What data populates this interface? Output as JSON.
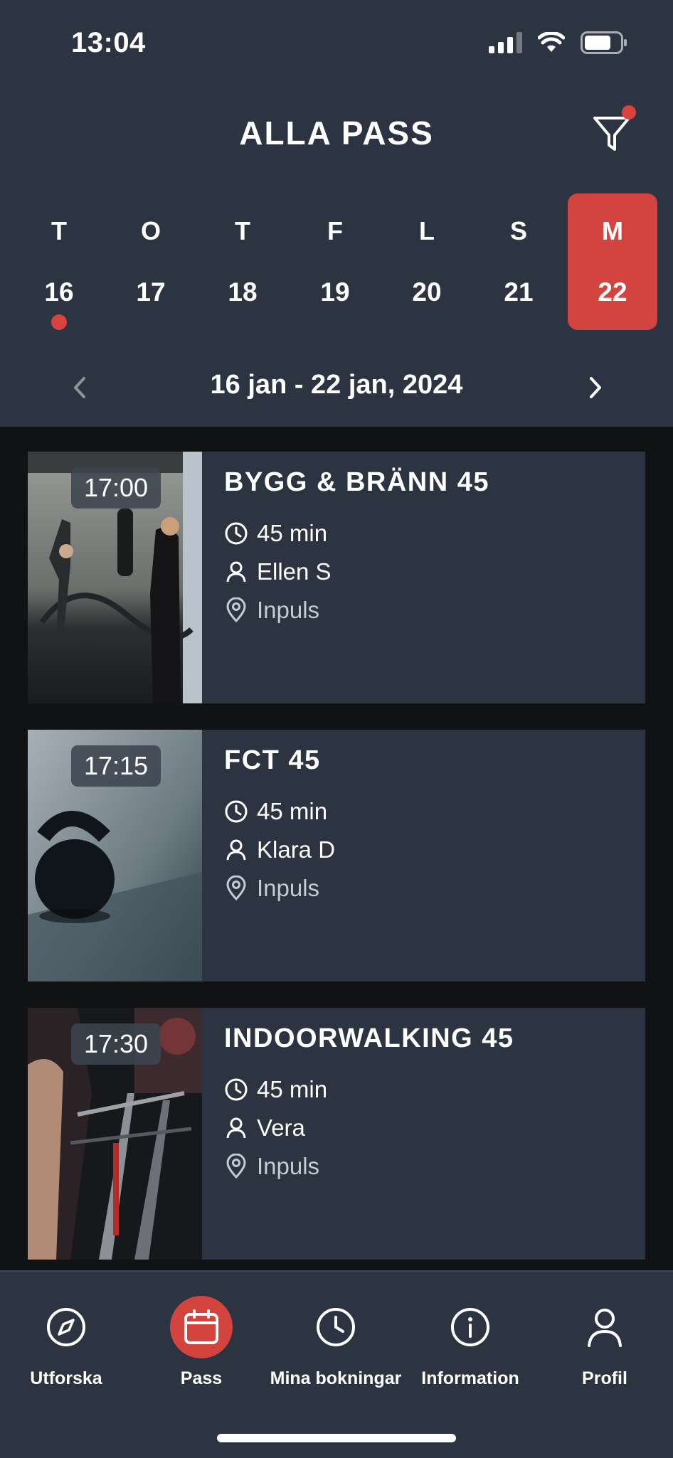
{
  "status_bar": {
    "time": "13:04"
  },
  "header": {
    "title": "ALLA PASS"
  },
  "week": {
    "days": [
      {
        "letter": "T",
        "number": "16",
        "has_dot": true,
        "selected": false
      },
      {
        "letter": "O",
        "number": "17",
        "has_dot": false,
        "selected": false
      },
      {
        "letter": "T",
        "number": "18",
        "has_dot": false,
        "selected": false
      },
      {
        "letter": "F",
        "number": "19",
        "has_dot": false,
        "selected": false
      },
      {
        "letter": "L",
        "number": "20",
        "has_dot": false,
        "selected": false
      },
      {
        "letter": "S",
        "number": "21",
        "has_dot": false,
        "selected": false
      },
      {
        "letter": "M",
        "number": "22",
        "has_dot": false,
        "selected": true
      }
    ],
    "range_label": "16 jan - 22 jan, 2024"
  },
  "classes": [
    {
      "time": "17:00",
      "title": "BYGG & BRÄNN 45",
      "duration": "45 min",
      "instructor": "Ellen S",
      "location": "Inpuls"
    },
    {
      "time": "17:15",
      "title": "FCT 45",
      "duration": "45 min",
      "instructor": "Klara D",
      "location": "Inpuls"
    },
    {
      "time": "17:30",
      "title": "INDOORWALKING 45",
      "duration": "45 min",
      "instructor": "Vera",
      "location": "Inpuls"
    }
  ],
  "tabbar": {
    "items": [
      {
        "label": "Utforska",
        "icon": "compass-icon",
        "active": false
      },
      {
        "label": "Pass",
        "icon": "calendar-icon",
        "active": true
      },
      {
        "label": "Mina bokningar",
        "icon": "clock-icon",
        "active": false
      },
      {
        "label": "Information",
        "icon": "info-icon",
        "active": false
      },
      {
        "label": "Profil",
        "icon": "person-icon",
        "active": false
      }
    ]
  },
  "colors": {
    "header_bg": "#2b3440",
    "list_bg": "#111214",
    "accent": "#d4443f",
    "card_bg": "#2b3440"
  }
}
